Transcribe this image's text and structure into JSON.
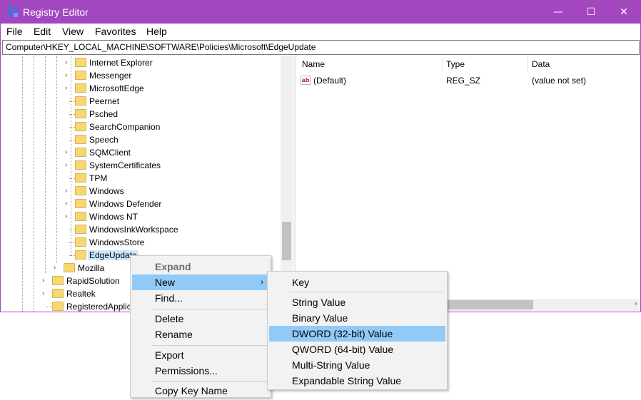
{
  "window": {
    "title": "Registry Editor",
    "minimize": "—",
    "maximize": "☐",
    "close": "✕"
  },
  "menubar": [
    "File",
    "Edit",
    "View",
    "Favorites",
    "Help"
  ],
  "address": "Computer\\HKEY_LOCAL_MACHINE\\SOFTWARE\\Policies\\Microsoft\\EdgeUpdate",
  "tree": {
    "items": [
      {
        "label": "Internet Explorer",
        "expandable": true
      },
      {
        "label": "Messenger",
        "expandable": true
      },
      {
        "label": "MicrosoftEdge",
        "expandable": true
      },
      {
        "label": "Peernet",
        "expandable": false
      },
      {
        "label": "Psched",
        "expandable": false
      },
      {
        "label": "SearchCompanion",
        "expandable": false
      },
      {
        "label": "Speech",
        "expandable": false
      },
      {
        "label": "SQMClient",
        "expandable": true
      },
      {
        "label": "SystemCertificates",
        "expandable": true
      },
      {
        "label": "TPM",
        "expandable": false
      },
      {
        "label": "Windows",
        "expandable": true
      },
      {
        "label": "Windows Defender",
        "expandable": true
      },
      {
        "label": "Windows NT",
        "expandable": true
      },
      {
        "label": "WindowsInkWorkspace",
        "expandable": false
      },
      {
        "label": "WindowsStore",
        "expandable": false
      },
      {
        "label": "EdgeUpdate",
        "expandable": false
      }
    ],
    "level2": [
      {
        "label": "Mozilla",
        "expandable": true
      }
    ],
    "level1": [
      {
        "label": "RapidSolution",
        "expandable": true
      },
      {
        "label": "Realtek",
        "expandable": true
      },
      {
        "label": "RegisteredApplic",
        "expandable": false
      }
    ]
  },
  "values": {
    "headers": {
      "name": "Name",
      "type": "Type",
      "data": "Data"
    },
    "rows": [
      {
        "name": "(Default)",
        "type": "REG_SZ",
        "data": "(value not set)",
        "icon": "string-value-icon"
      }
    ],
    "icon_text": "ab"
  },
  "context_menu": {
    "items": [
      "Expand",
      "New",
      "Find...",
      "Delete",
      "Rename",
      "Export",
      "Permissions...",
      "Copy Key Name"
    ],
    "arrow": "›"
  },
  "submenu": {
    "items": [
      "Key",
      "String Value",
      "Binary Value",
      "DWORD (32-bit) Value",
      "QWORD (64-bit) Value",
      "Multi-String Value",
      "Expandable String Value"
    ]
  },
  "colors": {
    "titlebar": "#a347c0",
    "highlight": "#91c9f7",
    "folder": "#f7d774"
  }
}
